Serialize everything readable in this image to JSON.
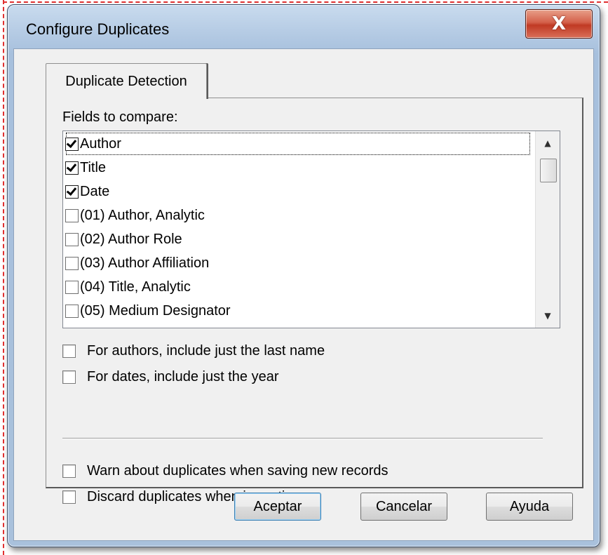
{
  "window": {
    "title": "Configure Duplicates",
    "close_label": "X"
  },
  "tab": {
    "label": "Duplicate Detection"
  },
  "fields": {
    "label": "Fields to compare:",
    "items": [
      {
        "label": "Author",
        "checked": true
      },
      {
        "label": "Title",
        "checked": true
      },
      {
        "label": "Date",
        "checked": true
      },
      {
        "label": "(01) Author, Analytic",
        "checked": false
      },
      {
        "label": "(02) Author Role",
        "checked": false
      },
      {
        "label": "(03) Author Affiliation",
        "checked": false
      },
      {
        "label": "(04) Title, Analytic",
        "checked": false
      },
      {
        "label": "(05) Medium Designator",
        "checked": false
      }
    ],
    "scroll_up_icon": "▲",
    "scroll_down_icon": "▼"
  },
  "options": {
    "authors_last_name": "For authors, include just the last name",
    "dates_year": "For dates, include just the year",
    "warn_duplicates": "Warn about duplicates when saving new records",
    "discard_duplicates": "Discard duplicates when importing"
  },
  "buttons": {
    "accept": "Aceptar",
    "cancel": "Cancelar",
    "help": "Ayuda"
  }
}
